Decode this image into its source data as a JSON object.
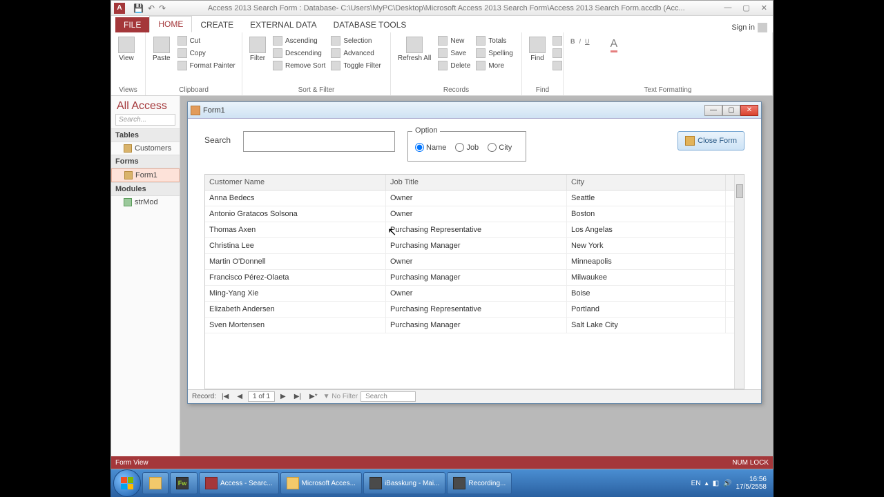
{
  "titlebar": {
    "title": "Access 2013 Search Form : Database- C:\\Users\\MyPC\\Desktop\\Microsoft Access 2013 Search Form\\Access 2013 Search Form.accdb (Acc..."
  },
  "tabs": {
    "file": "FILE",
    "home": "HOME",
    "create": "CREATE",
    "external": "EXTERNAL DATA",
    "dbtools": "DATABASE TOOLS",
    "signin": "Sign in"
  },
  "ribbon": {
    "views": {
      "view": "View",
      "group": "Views"
    },
    "clipboard": {
      "paste": "Paste",
      "cut": "Cut",
      "copy": "Copy",
      "painter": "Format Painter",
      "group": "Clipboard"
    },
    "sortfilter": {
      "filter": "Filter",
      "asc": "Ascending",
      "desc": "Descending",
      "remove": "Remove Sort",
      "selection": "Selection",
      "advanced": "Advanced",
      "toggle": "Toggle Filter",
      "group": "Sort & Filter"
    },
    "records": {
      "refresh": "Refresh All",
      "new": "New",
      "save": "Save",
      "delete": "Delete",
      "totals": "Totals",
      "spelling": "Spelling",
      "more": "More",
      "group": "Records"
    },
    "find": {
      "find": "Find",
      "group": "Find"
    },
    "textfmt": {
      "group": "Text Formatting"
    }
  },
  "nav": {
    "title": "All Access",
    "search": "Search...",
    "grp_tables": "Tables",
    "customers": "Customers",
    "grp_forms": "Forms",
    "form1": "Form1",
    "grp_modules": "Modules",
    "strmod": "strMod"
  },
  "form": {
    "title": "Form1",
    "search_label": "Search",
    "option_label": "Option",
    "opt_name": "Name",
    "opt_job": "Job",
    "opt_city": "City",
    "close_btn": "Close Form"
  },
  "grid": {
    "col_name": "Customer Name",
    "col_job": "Job Title",
    "col_city": "City",
    "rows": [
      {
        "name": "Anna Bedecs",
        "job": "Owner",
        "city": "Seattle"
      },
      {
        "name": "Antonio Gratacos Solsona",
        "job": "Owner",
        "city": "Boston"
      },
      {
        "name": "Thomas Axen",
        "job": "Purchasing Representative",
        "city": "Los Angelas"
      },
      {
        "name": "Christina Lee",
        "job": "Purchasing Manager",
        "city": "New York"
      },
      {
        "name": "Martin O'Donnell",
        "job": "Owner",
        "city": "Minneapolis"
      },
      {
        "name": "Francisco Pérez-Olaeta",
        "job": "Purchasing Manager",
        "city": "Milwaukee"
      },
      {
        "name": "Ming-Yang Xie",
        "job": "Owner",
        "city": "Boise"
      },
      {
        "name": "Elizabeth Andersen",
        "job": "Purchasing Representative",
        "city": "Portland"
      },
      {
        "name": "Sven Mortensen",
        "job": "Purchasing Manager",
        "city": "Salt Lake City"
      }
    ]
  },
  "recnav": {
    "label": "Record:",
    "pos": "1 of 1",
    "nofilter": "No Filter",
    "search": "Search"
  },
  "status": {
    "left": "Form View",
    "right": "NUM LOCK"
  },
  "taskbar": {
    "items": [
      {
        "cls": "fw",
        "label": "",
        "ico": "Fw"
      },
      {
        "cls": "acc",
        "label": "Access - Searc..."
      },
      {
        "cls": "folder",
        "label": "Microsoft Acces..."
      },
      {
        "cls": "rec",
        "label": "iBasskung - Mai..."
      },
      {
        "cls": "rec",
        "label": "Recording..."
      }
    ],
    "lang": "EN",
    "time": "16:56",
    "date": "17/5/2558"
  }
}
